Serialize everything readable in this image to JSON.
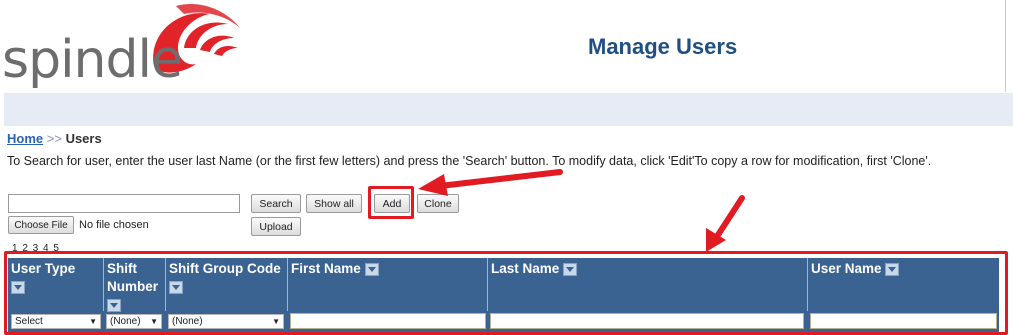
{
  "header": {
    "logo_text": "spindle",
    "title": "Manage Users"
  },
  "breadcrumb": {
    "home": "Home",
    "separator": ">>",
    "current": "Users"
  },
  "instructions": "To Search for user, enter the user last Name (or the first few letters) and press the 'Search' button. To modify data, click 'Edit'To copy a row for modification, first 'Clone'.",
  "search": {
    "value": "",
    "placeholder": ""
  },
  "file": {
    "choose_label": "Choose File",
    "status": "No file chosen"
  },
  "buttons": {
    "search": "Search",
    "show_all": "Show all",
    "add": "Add",
    "clone": "Clone",
    "upload": "Upload"
  },
  "pager": "1 2 3 4 5",
  "grid": {
    "columns": [
      "User Type",
      "Shift Number",
      "Shift Group Code",
      "First Name",
      "Last Name",
      "User Name"
    ],
    "filters": {
      "user_type": "Select",
      "shift_number": "(None)",
      "shift_group_code": "(None)"
    }
  },
  "colors": {
    "title": "#1f4f85",
    "grid_header": "#3a6391",
    "annotation": "#e21b22",
    "logo_swirl": "#e0242a"
  }
}
